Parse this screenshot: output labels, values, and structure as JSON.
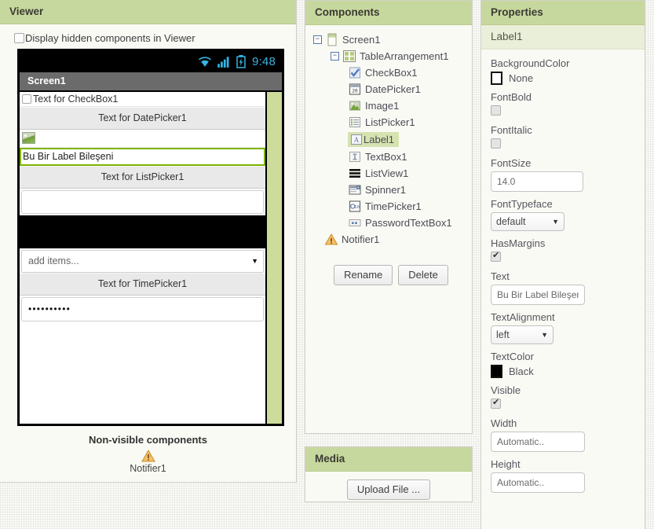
{
  "viewer": {
    "title": "Viewer",
    "hidden_checkbox_label": "Display hidden components in Viewer",
    "phone": {
      "status_time": "9:48",
      "screen_title": "Screen1",
      "widgets": {
        "checkbox_text": "Text for CheckBox1",
        "datepicker_text": "Text for DatePicker1",
        "label_text": "Bu Bir Label Bileşeni",
        "listpicker_text": "Text for ListPicker1",
        "spinner_text": "add items...",
        "timepicker_text": "Text for TimePicker1",
        "password_text": "••••••••••"
      }
    },
    "nonvisible_title": "Non-visible components",
    "nonvisible_items": [
      {
        "label": "Notifier1",
        "icon": "warning-triangle-icon"
      }
    ]
  },
  "components": {
    "title": "Components",
    "tree": [
      {
        "label": "Screen1",
        "icon": "screen-icon",
        "depth": 0,
        "twisty": "−",
        "selected": false
      },
      {
        "label": "TableArrangement1",
        "icon": "table-arrangement-icon",
        "depth": 1,
        "twisty": "−",
        "selected": false
      },
      {
        "label": "CheckBox1",
        "icon": "checkbox-icon",
        "depth": 2,
        "twisty": "",
        "selected": false
      },
      {
        "label": "DatePicker1",
        "icon": "datepicker-icon",
        "depth": 2,
        "twisty": "",
        "selected": false
      },
      {
        "label": "Image1",
        "icon": "image-icon",
        "depth": 2,
        "twisty": "",
        "selected": false
      },
      {
        "label": "ListPicker1",
        "icon": "listpicker-icon",
        "depth": 2,
        "twisty": "",
        "selected": false
      },
      {
        "label": "Label1",
        "icon": "label-icon",
        "depth": 2,
        "twisty": "",
        "selected": true
      },
      {
        "label": "TextBox1",
        "icon": "textbox-icon",
        "depth": 2,
        "twisty": "",
        "selected": false
      },
      {
        "label": "ListView1",
        "icon": "listview-icon",
        "depth": 2,
        "twisty": "",
        "selected": false
      },
      {
        "label": "Spinner1",
        "icon": "spinner-icon",
        "depth": 2,
        "twisty": "",
        "selected": false
      },
      {
        "label": "TimePicker1",
        "icon": "timepicker-icon",
        "depth": 2,
        "twisty": "",
        "selected": false
      },
      {
        "label": "PasswordTextBox1",
        "icon": "password-textbox-icon",
        "depth": 2,
        "twisty": "",
        "selected": false
      },
      {
        "label": "Notifier1",
        "icon": "warning-triangle-icon",
        "depth": 1,
        "twisty": "",
        "selected": false
      }
    ],
    "rename_label": "Rename",
    "delete_label": "Delete"
  },
  "media": {
    "title": "Media",
    "upload_label": "Upload File ..."
  },
  "properties": {
    "title": "Properties",
    "selected_component": "Label1",
    "items": [
      {
        "name": "BackgroundColor",
        "kind": "color",
        "value": "None",
        "swatch": "#ffffff"
      },
      {
        "name": "FontBold",
        "kind": "checkbox",
        "checked": false
      },
      {
        "name": "FontItalic",
        "kind": "checkbox",
        "checked": false
      },
      {
        "name": "FontSize",
        "kind": "input",
        "value": "14.0"
      },
      {
        "name": "FontTypeface",
        "kind": "select",
        "value": "default"
      },
      {
        "name": "HasMargins",
        "kind": "checkbox",
        "checked": true
      },
      {
        "name": "Text",
        "kind": "input",
        "value": "Bu Bir Label Bileşeni"
      },
      {
        "name": "TextAlignment",
        "kind": "select",
        "value": "left"
      },
      {
        "name": "TextColor",
        "kind": "color",
        "value": "Black",
        "swatch": "#000000"
      },
      {
        "name": "Visible",
        "kind": "checkbox",
        "checked": true
      },
      {
        "name": "Width",
        "kind": "input",
        "value": "Automatic.."
      },
      {
        "name": "Height",
        "kind": "input",
        "value": "Automatic.."
      }
    ]
  },
  "colors": {
    "panel_header": "#c7d89e",
    "selection": "#d6e3b0",
    "accent_green": "#7db500",
    "status_icon": "#33b5e5"
  }
}
